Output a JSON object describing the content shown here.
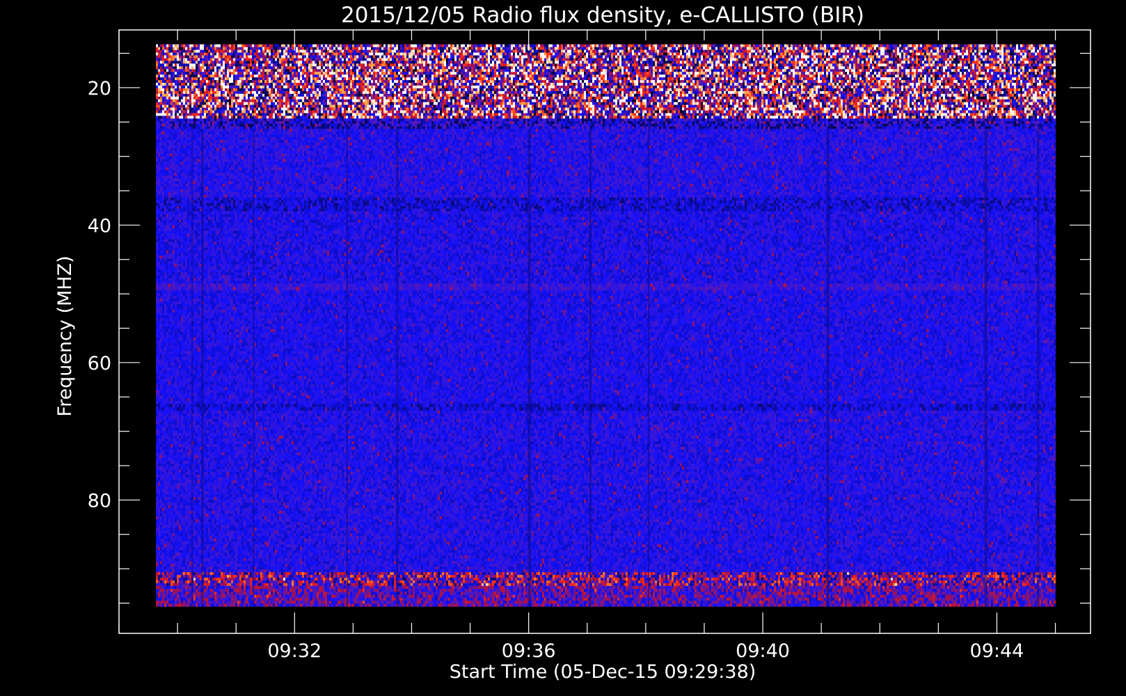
{
  "chart_data": {
    "type": "heatmap",
    "title": "2015/12/05  Radio flux density, e-CALLISTO (BIR)",
    "xlabel": "Start Time (05-Dec-15 09:29:38)",
    "ylabel": "Frequency (MHZ)",
    "x_axis": {
      "unit": "minutes after 09:00 UT",
      "range": [
        29.0,
        45.6
      ],
      "data_range": [
        29.63,
        45.0
      ],
      "major_ticks": [
        {
          "value": 32,
          "label": "09:32"
        },
        {
          "value": 36,
          "label": "09:36"
        },
        {
          "value": 40,
          "label": "09:40"
        },
        {
          "value": 44,
          "label": "09:44"
        }
      ],
      "minor_tick_step": 1
    },
    "y_axis": {
      "unit": "MHz",
      "reversed": true,
      "range": [
        11.6,
        99.4
      ],
      "data_range": [
        13.7,
        95.5
      ],
      "major_ticks": [
        {
          "value": 20,
          "label": "20"
        },
        {
          "value": 40,
          "label": "40"
        },
        {
          "value": 60,
          "label": "60"
        },
        {
          "value": 80,
          "label": "80"
        }
      ],
      "minor_tick_step": 5
    },
    "colormap": [
      "#000000",
      "#0a0a78",
      "#1010ff",
      "#4818c8",
      "#b01040",
      "#ff2810",
      "#ff9a3c",
      "#ffffff"
    ],
    "bands": [
      {
        "f0": 13.7,
        "f1": 24.5,
        "intensity": 0.58,
        "variability": 0.55
      },
      {
        "f0": 24.5,
        "f1": 26.0,
        "intensity": 0.28,
        "variability": 0.2
      },
      {
        "f0": 26.0,
        "f1": 36.0,
        "intensity": 0.33,
        "variability": 0.1
      },
      {
        "f0": 36.0,
        "f1": 38.0,
        "intensity": 0.25,
        "variability": 0.12
      },
      {
        "f0": 38.0,
        "f1": 48.5,
        "intensity": 0.31,
        "variability": 0.1
      },
      {
        "f0": 48.5,
        "f1": 49.5,
        "intensity": 0.38,
        "variability": 0.08
      },
      {
        "f0": 49.5,
        "f1": 66.0,
        "intensity": 0.31,
        "variability": 0.09
      },
      {
        "f0": 66.0,
        "f1": 67.0,
        "intensity": 0.25,
        "variability": 0.1
      },
      {
        "f0": 67.0,
        "f1": 90.5,
        "intensity": 0.32,
        "variability": 0.1
      },
      {
        "f0": 90.5,
        "f1": 92.5,
        "intensity": 0.47,
        "variability": 0.35
      },
      {
        "f0": 92.5,
        "f1": 95.5,
        "intensity": 0.42,
        "variability": 0.2
      }
    ],
    "dark_columns": [
      30.25,
      30.42,
      31.3,
      32.9,
      33.75,
      36.0,
      37.05,
      38.05,
      41.1,
      43.8,
      44.7
    ]
  }
}
